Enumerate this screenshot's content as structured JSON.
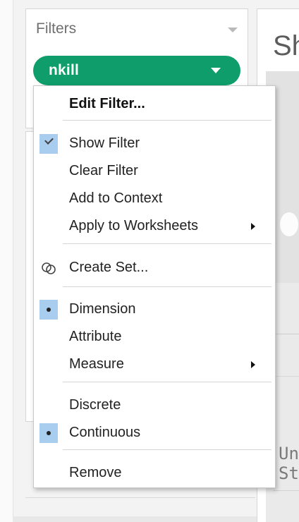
{
  "filters_panel": {
    "title": "Filters",
    "pill": {
      "label": "nkill",
      "color": "#0f9d6b"
    }
  },
  "sheet": {
    "title_fragment": "Sh",
    "map_label_line1": "Uni",
    "map_label_line2": "Sta"
  },
  "context_menu": {
    "items": [
      {
        "label": "Edit Filter...",
        "style": "bold"
      },
      {
        "label": "Show Filter",
        "checked": true,
        "indicator": "check"
      },
      {
        "label": "Clear Filter"
      },
      {
        "label": "Add to Context"
      },
      {
        "label": "Apply to Worksheets",
        "submenu": true
      },
      {
        "label": "Create Set...",
        "icon": "create-set-icon"
      },
      {
        "label": "Dimension",
        "selected": true,
        "indicator": "radio"
      },
      {
        "label": "Attribute"
      },
      {
        "label": "Measure",
        "submenu": true
      },
      {
        "label": "Discrete"
      },
      {
        "label": "Continuous",
        "selected": true,
        "indicator": "radio"
      },
      {
        "label": "Remove"
      }
    ],
    "highlight_color": "#a9cdef"
  }
}
